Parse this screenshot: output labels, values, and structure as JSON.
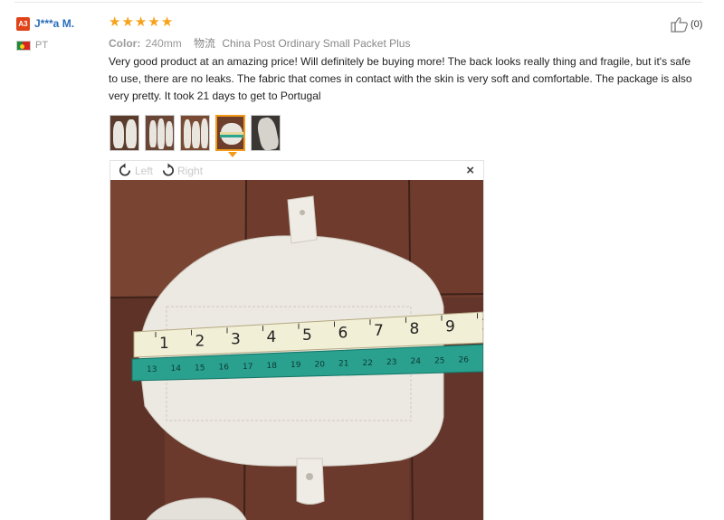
{
  "user": {
    "level": "A3",
    "name": "J***a M.",
    "country": "PT"
  },
  "review": {
    "rating": 5,
    "color_label": "Color:",
    "color_value": "240mm",
    "shipping_label": "物流",
    "shipping_value": "China Post Ordinary Small Packet Plus",
    "text": "Very good product at an amazing price! Will definitely be buying more! The back looks really thing and fragile, but it's safe to use, there are no leaks. The fabric that comes in contact with the skin is very soft and comfortable. The package is also very pretty. It took 21 days to get to Portugal"
  },
  "helpful": {
    "count": "(0)"
  },
  "viewer": {
    "rotate_left": "Left",
    "rotate_right": "Right",
    "close": "×",
    "ruler_numbers": [
      "1",
      "2",
      "3",
      "4",
      "5",
      "6",
      "7",
      "8",
      "9",
      "1"
    ],
    "tape_numbers": [
      "13",
      "14",
      "15",
      "16",
      "17",
      "18",
      "19",
      "20",
      "21",
      "22",
      "23",
      "24",
      "25",
      "26"
    ]
  },
  "colors": {
    "accent": "#f39a19",
    "star": "#f7a21b",
    "link": "#2a6ebb",
    "badge": "#e0421a"
  }
}
